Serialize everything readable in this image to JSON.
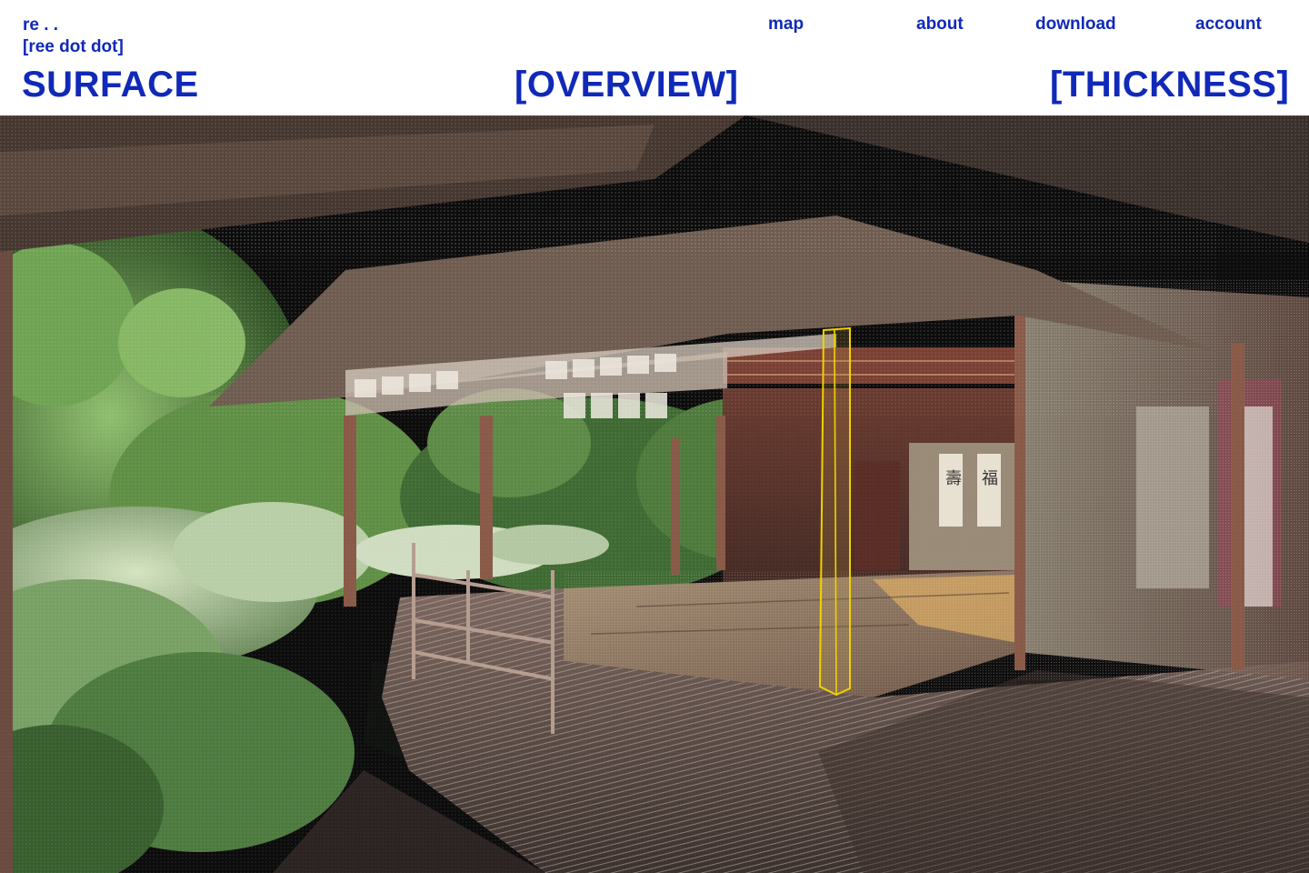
{
  "brand": {
    "line1": "re . .",
    "line2": "[ree dot dot]"
  },
  "nav": {
    "map": "map",
    "about": "about",
    "download": "download",
    "account": "account"
  },
  "modes": {
    "surface": "SURFACE",
    "overview": "[OVERVIEW]",
    "thickness": "[THICKNESS]"
  },
  "colors": {
    "accent": "#1029b8",
    "selection": "#f2d000",
    "background": "#ffffff"
  },
  "viewer": {
    "scene": "point-cloud scan of a Japanese tea house veranda and garden",
    "selected_element": "pillar"
  }
}
